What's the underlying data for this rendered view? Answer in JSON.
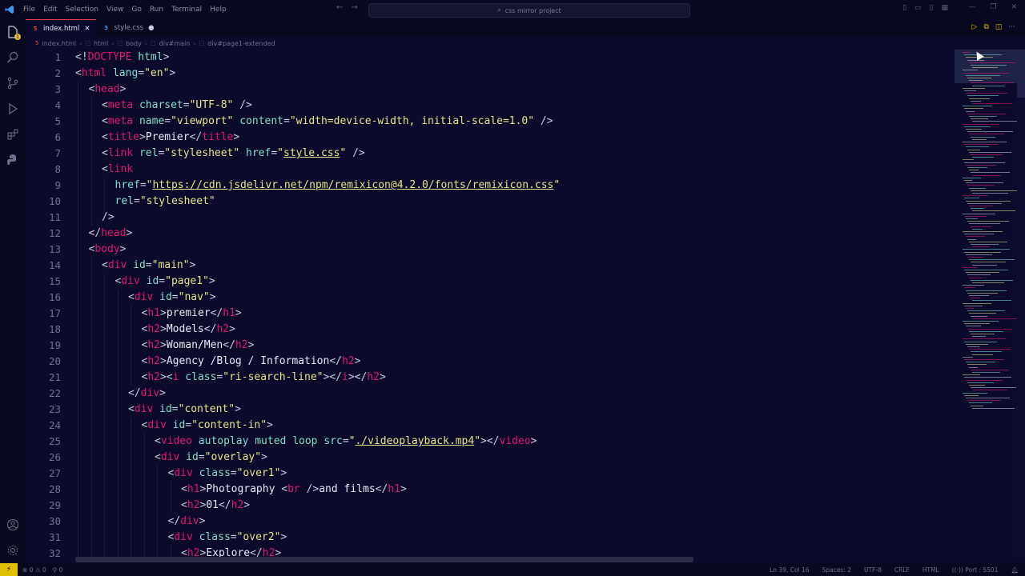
{
  "titlebar": {
    "menu": [
      "File",
      "Edit",
      "Selection",
      "View",
      "Go",
      "Run",
      "Terminal",
      "Help"
    ],
    "search": "css mirror project"
  },
  "tabs": [
    {
      "label": "index.html",
      "icon": "html-file-icon",
      "active": true
    },
    {
      "label": "style.css",
      "icon": "css-file-icon",
      "active": false
    }
  ],
  "breadcrumb": [
    "index.html",
    "html",
    "body",
    "div#main",
    "div#page1-extended"
  ],
  "code_lines": [
    {
      "n": "1",
      "indent": 0,
      "t": [
        [
          "p",
          "<!"
        ],
        [
          "t",
          "DOCTYPE"
        ],
        [
          "a",
          " html"
        ],
        [
          "p",
          ">"
        ]
      ]
    },
    {
      "n": "2",
      "indent": 0,
      "t": [
        [
          "p",
          "<"
        ],
        [
          "t",
          "html"
        ],
        [
          "a",
          " lang"
        ],
        [
          "p",
          "="
        ],
        [
          "s",
          "\"en\""
        ],
        [
          "p",
          ">"
        ]
      ]
    },
    {
      "n": "3",
      "indent": 1,
      "t": [
        [
          "p",
          "<"
        ],
        [
          "t",
          "head"
        ],
        [
          "p",
          ">"
        ]
      ]
    },
    {
      "n": "4",
      "indent": 2,
      "t": [
        [
          "p",
          "<"
        ],
        [
          "t",
          "meta"
        ],
        [
          "a",
          " charset"
        ],
        [
          "p",
          "="
        ],
        [
          "s",
          "\"UTF-8\""
        ],
        [
          "p",
          " />"
        ]
      ]
    },
    {
      "n": "5",
      "indent": 2,
      "t": [
        [
          "p",
          "<"
        ],
        [
          "t",
          "meta"
        ],
        [
          "a",
          " name"
        ],
        [
          "p",
          "="
        ],
        [
          "s",
          "\"viewport\""
        ],
        [
          "a",
          " content"
        ],
        [
          "p",
          "="
        ],
        [
          "s",
          "\"width=device-width, initial-scale=1.0\""
        ],
        [
          "p",
          " />"
        ]
      ]
    },
    {
      "n": "6",
      "indent": 2,
      "t": [
        [
          "p",
          "<"
        ],
        [
          "t",
          "title"
        ],
        [
          "p",
          ">"
        ],
        [
          "x",
          "Premier"
        ],
        [
          "p",
          "</"
        ],
        [
          "t",
          "title"
        ],
        [
          "p",
          ">"
        ]
      ]
    },
    {
      "n": "7",
      "indent": 2,
      "t": [
        [
          "p",
          "<"
        ],
        [
          "t",
          "link"
        ],
        [
          "a",
          " rel"
        ],
        [
          "p",
          "="
        ],
        [
          "s",
          "\"stylesheet\""
        ],
        [
          "a",
          " href"
        ],
        [
          "p",
          "="
        ],
        [
          "s",
          "\""
        ],
        [
          "l",
          "style.css"
        ],
        [
          "s",
          "\""
        ],
        [
          "p",
          " />"
        ]
      ]
    },
    {
      "n": "8",
      "indent": 2,
      "t": [
        [
          "p",
          "<"
        ],
        [
          "t",
          "link"
        ]
      ]
    },
    {
      "n": "9",
      "indent": 3,
      "t": [
        [
          "a",
          "href"
        ],
        [
          "p",
          "="
        ],
        [
          "s",
          "\""
        ],
        [
          "l",
          "https://cdn.jsdelivr.net/npm/remixicon@4.2.0/fonts/remixicon.css"
        ],
        [
          "s",
          "\""
        ]
      ]
    },
    {
      "n": "10",
      "indent": 3,
      "t": [
        [
          "a",
          "rel"
        ],
        [
          "p",
          "="
        ],
        [
          "s",
          "\"stylesheet\""
        ]
      ]
    },
    {
      "n": "11",
      "indent": 2,
      "t": [
        [
          "p",
          "/>"
        ]
      ]
    },
    {
      "n": "12",
      "indent": 1,
      "t": [
        [
          "p",
          "</"
        ],
        [
          "t",
          "head"
        ],
        [
          "p",
          ">"
        ]
      ]
    },
    {
      "n": "13",
      "indent": 1,
      "t": [
        [
          "p",
          "<"
        ],
        [
          "t",
          "body"
        ],
        [
          "p",
          ">"
        ]
      ]
    },
    {
      "n": "14",
      "indent": 2,
      "t": [
        [
          "p",
          "<"
        ],
        [
          "t",
          "div"
        ],
        [
          "a",
          " id"
        ],
        [
          "p",
          "="
        ],
        [
          "s",
          "\"main\""
        ],
        [
          "p",
          ">"
        ]
      ]
    },
    {
      "n": "15",
      "indent": 3,
      "t": [
        [
          "p",
          "<"
        ],
        [
          "t",
          "div"
        ],
        [
          "a",
          " id"
        ],
        [
          "p",
          "="
        ],
        [
          "s",
          "\"page1\""
        ],
        [
          "p",
          ">"
        ]
      ]
    },
    {
      "n": "16",
      "indent": 4,
      "t": [
        [
          "p",
          "<"
        ],
        [
          "t",
          "div"
        ],
        [
          "a",
          " id"
        ],
        [
          "p",
          "="
        ],
        [
          "s",
          "\"nav\""
        ],
        [
          "p",
          ">"
        ]
      ]
    },
    {
      "n": "17",
      "indent": 5,
      "t": [
        [
          "p",
          "<"
        ],
        [
          "t",
          "h1"
        ],
        [
          "p",
          ">"
        ],
        [
          "x",
          "premier"
        ],
        [
          "p",
          "</"
        ],
        [
          "t",
          "h1"
        ],
        [
          "p",
          ">"
        ]
      ]
    },
    {
      "n": "18",
      "indent": 5,
      "t": [
        [
          "p",
          "<"
        ],
        [
          "t",
          "h2"
        ],
        [
          "p",
          ">"
        ],
        [
          "x",
          "Models"
        ],
        [
          "p",
          "</"
        ],
        [
          "t",
          "h2"
        ],
        [
          "p",
          ">"
        ]
      ]
    },
    {
      "n": "19",
      "indent": 5,
      "t": [
        [
          "p",
          "<"
        ],
        [
          "t",
          "h2"
        ],
        [
          "p",
          ">"
        ],
        [
          "x",
          "Woman/Men"
        ],
        [
          "p",
          "</"
        ],
        [
          "t",
          "h2"
        ],
        [
          "p",
          ">"
        ]
      ]
    },
    {
      "n": "20",
      "indent": 5,
      "t": [
        [
          "p",
          "<"
        ],
        [
          "t",
          "h2"
        ],
        [
          "p",
          ">"
        ],
        [
          "x",
          "Agency /Blog / Information"
        ],
        [
          "p",
          "</"
        ],
        [
          "t",
          "h2"
        ],
        [
          "p",
          ">"
        ]
      ]
    },
    {
      "n": "21",
      "indent": 5,
      "t": [
        [
          "p",
          "<"
        ],
        [
          "t",
          "h2"
        ],
        [
          "p",
          "><"
        ],
        [
          "t",
          "i"
        ],
        [
          "a",
          " class"
        ],
        [
          "p",
          "="
        ],
        [
          "s",
          "\"ri-search-line\""
        ],
        [
          "p",
          "></"
        ],
        [
          "t",
          "i"
        ],
        [
          "p",
          "></"
        ],
        [
          "t",
          "h2"
        ],
        [
          "p",
          ">"
        ]
      ]
    },
    {
      "n": "22",
      "indent": 4,
      "t": [
        [
          "p",
          "</"
        ],
        [
          "t",
          "div"
        ],
        [
          "p",
          ">"
        ]
      ]
    },
    {
      "n": "23",
      "indent": 4,
      "t": [
        [
          "p",
          "<"
        ],
        [
          "t",
          "div"
        ],
        [
          "a",
          " id"
        ],
        [
          "p",
          "="
        ],
        [
          "s",
          "\"content\""
        ],
        [
          "p",
          ">"
        ]
      ]
    },
    {
      "n": "24",
      "indent": 5,
      "t": [
        [
          "p",
          "<"
        ],
        [
          "t",
          "div"
        ],
        [
          "a",
          " id"
        ],
        [
          "p",
          "="
        ],
        [
          "s",
          "\"content-in\""
        ],
        [
          "p",
          ">"
        ]
      ]
    },
    {
      "n": "25",
      "indent": 6,
      "t": [
        [
          "p",
          "<"
        ],
        [
          "t",
          "video"
        ],
        [
          "a",
          " autoplay muted loop src"
        ],
        [
          "p",
          "="
        ],
        [
          "s",
          "\""
        ],
        [
          "l",
          "./videoplayback.mp4"
        ],
        [
          "s",
          "\""
        ],
        [
          "p",
          "></"
        ],
        [
          "t",
          "video"
        ],
        [
          "p",
          ">"
        ]
      ]
    },
    {
      "n": "26",
      "indent": 6,
      "t": [
        [
          "p",
          "<"
        ],
        [
          "t",
          "div"
        ],
        [
          "a",
          " id"
        ],
        [
          "p",
          "="
        ],
        [
          "s",
          "\"overlay\""
        ],
        [
          "p",
          ">"
        ]
      ]
    },
    {
      "n": "27",
      "indent": 7,
      "t": [
        [
          "p",
          "<"
        ],
        [
          "t",
          "div"
        ],
        [
          "a",
          " class"
        ],
        [
          "p",
          "="
        ],
        [
          "s",
          "\"over1\""
        ],
        [
          "p",
          ">"
        ]
      ]
    },
    {
      "n": "28",
      "indent": 8,
      "t": [
        [
          "p",
          "<"
        ],
        [
          "t",
          "h1"
        ],
        [
          "p",
          ">"
        ],
        [
          "x",
          "Photography "
        ],
        [
          "p",
          "<"
        ],
        [
          "t",
          "br"
        ],
        [
          "p",
          " />"
        ],
        [
          "x",
          "and films"
        ],
        [
          "p",
          "</"
        ],
        [
          "t",
          "h1"
        ],
        [
          "p",
          ">"
        ]
      ]
    },
    {
      "n": "29",
      "indent": 8,
      "t": [
        [
          "p",
          "<"
        ],
        [
          "t",
          "h2"
        ],
        [
          "p",
          ">"
        ],
        [
          "x",
          "01"
        ],
        [
          "p",
          "</"
        ],
        [
          "t",
          "h2"
        ],
        [
          "p",
          ">"
        ]
      ]
    },
    {
      "n": "30",
      "indent": 7,
      "t": [
        [
          "p",
          "</"
        ],
        [
          "t",
          "div"
        ],
        [
          "p",
          ">"
        ]
      ]
    },
    {
      "n": "31",
      "indent": 7,
      "t": [
        [
          "p",
          "<"
        ],
        [
          "t",
          "div"
        ],
        [
          "a",
          " class"
        ],
        [
          "p",
          "="
        ],
        [
          "s",
          "\"over2\""
        ],
        [
          "p",
          ">"
        ]
      ]
    },
    {
      "n": "32",
      "indent": 8,
      "t": [
        [
          "p",
          "<"
        ],
        [
          "t",
          "h2"
        ],
        [
          "p",
          ">"
        ],
        [
          "x",
          "Explore"
        ],
        [
          "p",
          "</"
        ],
        [
          "t",
          "h2"
        ],
        [
          "p",
          ">"
        ]
      ]
    }
  ],
  "status": {
    "errors": "0",
    "warnings": "0",
    "ports": "0",
    "position": "Ln 39, Col 16",
    "spaces": "Spaces: 2",
    "encoding": "UTF-8",
    "eol": "CRLF",
    "language": "HTML",
    "port": "Port : 5501"
  },
  "colors": {
    "background": "#0b0a2a",
    "tag": "#e0176f",
    "attribute": "#7fe0c8",
    "string": "#e6e38a",
    "text": "#e8e9f5",
    "status_remote": "#e0c000"
  }
}
